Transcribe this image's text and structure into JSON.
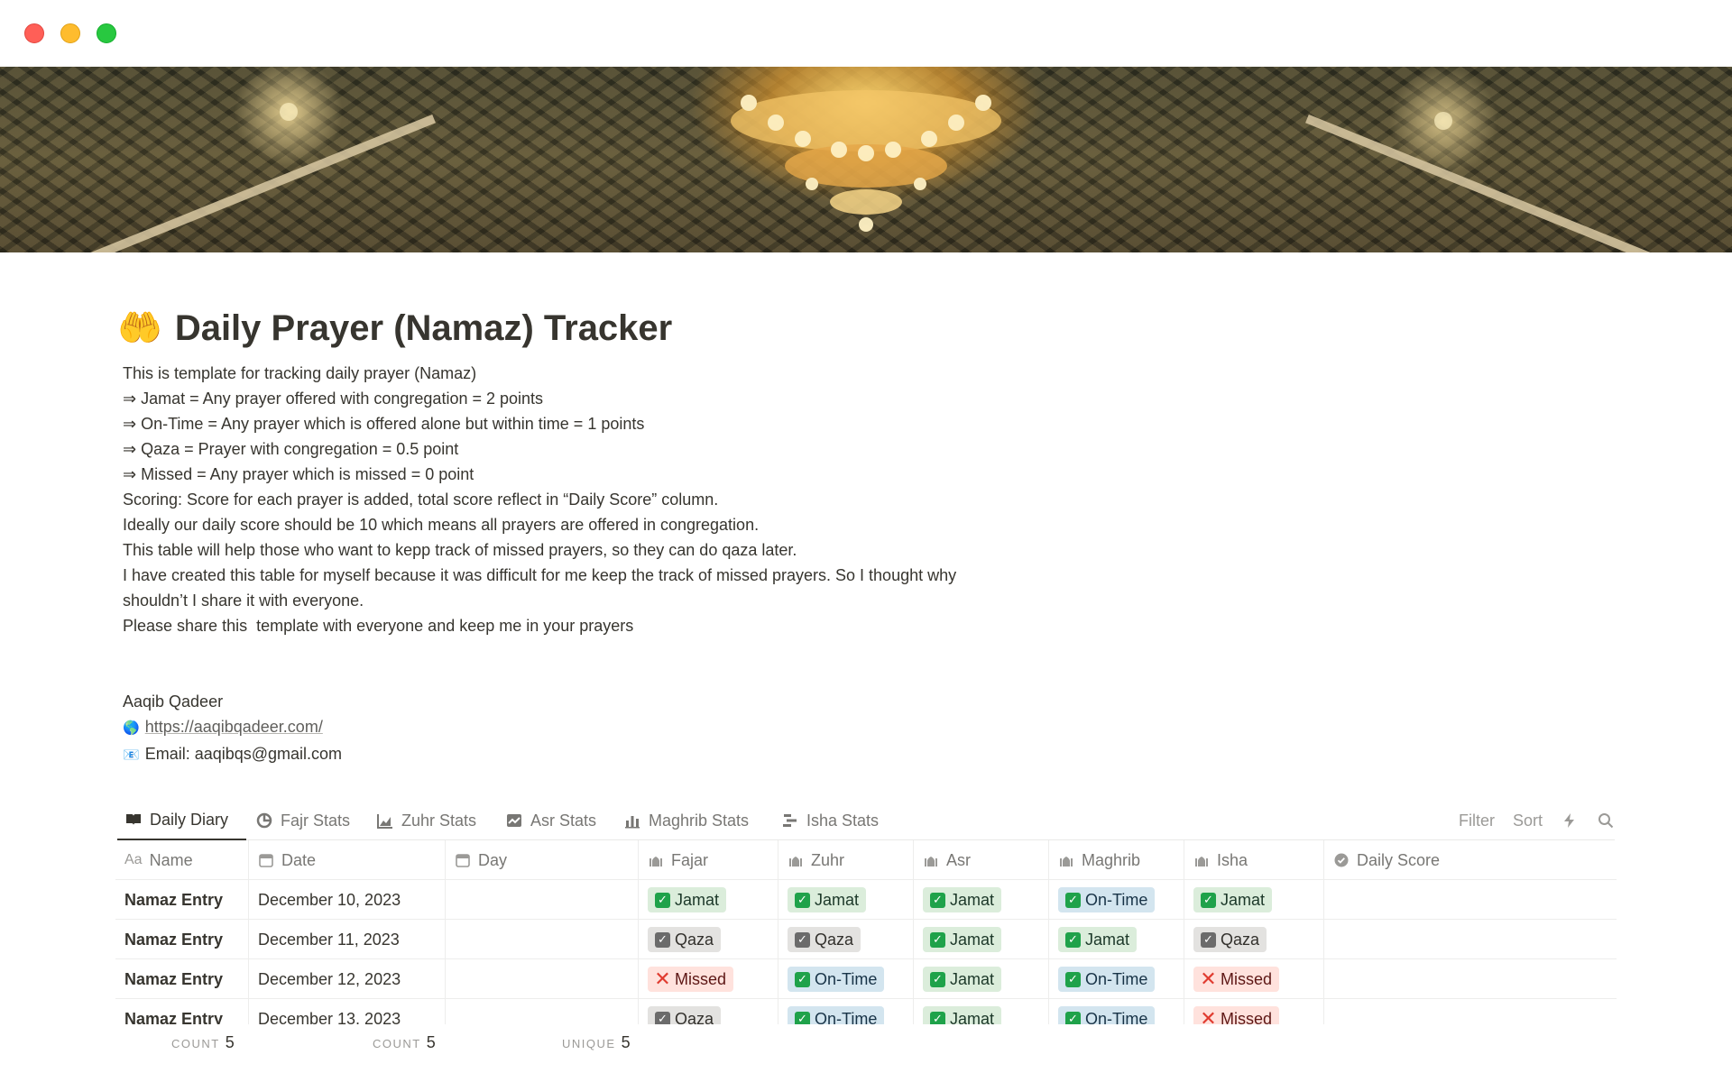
{
  "page": {
    "icon": "palms-up-together-emoji",
    "title": "Daily Prayer (Namaz) Tracker",
    "description": [
      "This is template for tracking daily prayer (Namaz)",
      "⇒ Jamat = Any prayer offered with congregation = 2 points",
      "⇒ On-Time = Any prayer which is offered alone but within time = 1 points",
      "⇒ Qaza = Prayer with congregation = 0.5 point",
      "⇒ Missed = Any prayer which is missed = 0 point",
      "Scoring: Score for each prayer is added, total score reflect in “Daily Score” column.",
      "Ideally our daily score should be 10 which means all prayers are offered in congregation.",
      "This table will help those who want to kepp track of missed prayers, so they can do qaza later.",
      "I have created this table for myself because it was difficult for me keep the track of missed prayers. So I thought why",
      "shouldn’t I share it with everyone.",
      "Please share this  template with everyone and keep me in your prayers"
    ],
    "author": {
      "name": "Aaqib Qadeer",
      "website": "https://aaqibqadeer.com/",
      "email": "Email: aaqibqs@gmail.com"
    }
  },
  "tabs": [
    {
      "label": "Daily Diary",
      "icon": "book-open-icon",
      "active": true
    },
    {
      "label": "Fajr Stats",
      "icon": "pie-chart-icon"
    },
    {
      "label": "Zuhr Stats",
      "icon": "area-chart-icon"
    },
    {
      "label": "Asr Stats",
      "icon": "line-chart-icon"
    },
    {
      "label": "Maghrib Stats",
      "icon": "bar-chart-icon"
    },
    {
      "label": "Isha Stats",
      "icon": "timeline-icon"
    }
  ],
  "toolbar": {
    "filter": "Filter",
    "sort": "Sort",
    "automation_icon": "lightning-icon",
    "search_icon": "search-icon"
  },
  "table": {
    "columns": [
      {
        "label": "Name",
        "icon": "text-aa-icon"
      },
      {
        "label": "Date",
        "icon": "calendar-icon"
      },
      {
        "label": "Day",
        "icon": "calendar-icon"
      },
      {
        "label": "Fajar",
        "icon": "mosque-icon"
      },
      {
        "label": "Zuhr",
        "icon": "mosque-icon"
      },
      {
        "label": "Asr",
        "icon": "mosque-icon"
      },
      {
        "label": "Maghrib",
        "icon": "mosque-icon"
      },
      {
        "label": "Isha",
        "icon": "mosque-icon"
      },
      {
        "label": "Daily Score",
        "icon": "check-circle-icon"
      }
    ],
    "rows": [
      {
        "name": "Namaz Entry",
        "date": "December 10, 2023",
        "day": "",
        "prayers": [
          "Jamat",
          "Jamat",
          "Jamat",
          "On-Time",
          "Jamat"
        ],
        "score": ""
      },
      {
        "name": "Namaz Entry",
        "date": "December 11, 2023",
        "day": "",
        "prayers": [
          "Qaza",
          "Qaza",
          "Jamat",
          "Jamat",
          "Qaza"
        ],
        "score": ""
      },
      {
        "name": "Namaz Entry",
        "date": "December 12, 2023",
        "day": "",
        "prayers": [
          "Missed",
          "On-Time",
          "Jamat",
          "On-Time",
          "Missed"
        ],
        "score": ""
      },
      {
        "name": "Namaz Entry",
        "date": "December 13, 2023",
        "day": "",
        "prayers": [
          "Qaza",
          "On-Time",
          "Jamat",
          "On-Time",
          "Missed"
        ],
        "score": ""
      }
    ],
    "footer": [
      {
        "label": "COUNT",
        "value": "5"
      },
      {
        "label": "COUNT",
        "value": "5"
      },
      {
        "label": "UNIQUE",
        "value": "5"
      }
    ]
  },
  "colors": {
    "jamat_bg": "#dbeddb",
    "ontime_bg": "#d3e5ef",
    "qaza_bg": "#e3e2e0",
    "missed_bg": "#ffe2dd",
    "check_green": "#1fa24a",
    "cross_red": "#e03b2f",
    "text": "#37352f"
  }
}
